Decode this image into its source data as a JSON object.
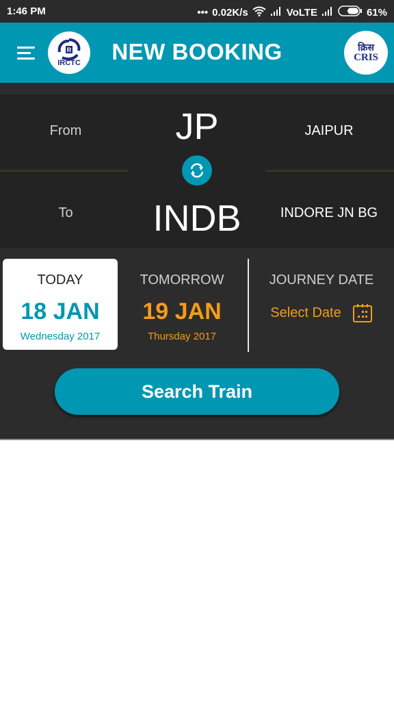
{
  "status_bar": {
    "time": "1:46 PM",
    "dots": "•••",
    "speed": "0.02K/s",
    "network": "VoLTE",
    "battery": "61%",
    "battery_level": 0.61
  },
  "app_bar": {
    "title": "NEW BOOKING",
    "left_logo_text": "IRCTC",
    "right_logo_text": "CRIS",
    "right_logo_hindi": "क्रिस"
  },
  "stations": {
    "from_label": "From",
    "from_code": "JP",
    "from_name": "JAIPUR",
    "to_label": "To",
    "to_code": "INDB",
    "to_name": "INDORE JN BG"
  },
  "dates": {
    "today": {
      "label": "TODAY",
      "date": "18 JAN",
      "sub": "Wednesday 2017",
      "selected": true
    },
    "tomorrow": {
      "label": "TOMORROW",
      "date": "19 JAN",
      "sub": "Thursday 2017",
      "selected": false
    },
    "journey": {
      "label": "JOURNEY DATE",
      "select_text": "Select Date"
    }
  },
  "actions": {
    "search_label": "Search Train"
  },
  "colors": {
    "primary": "#0097b2",
    "accent": "#f39c1a",
    "dark_bg": "#232323",
    "panel_bg": "#2c2c2c"
  }
}
